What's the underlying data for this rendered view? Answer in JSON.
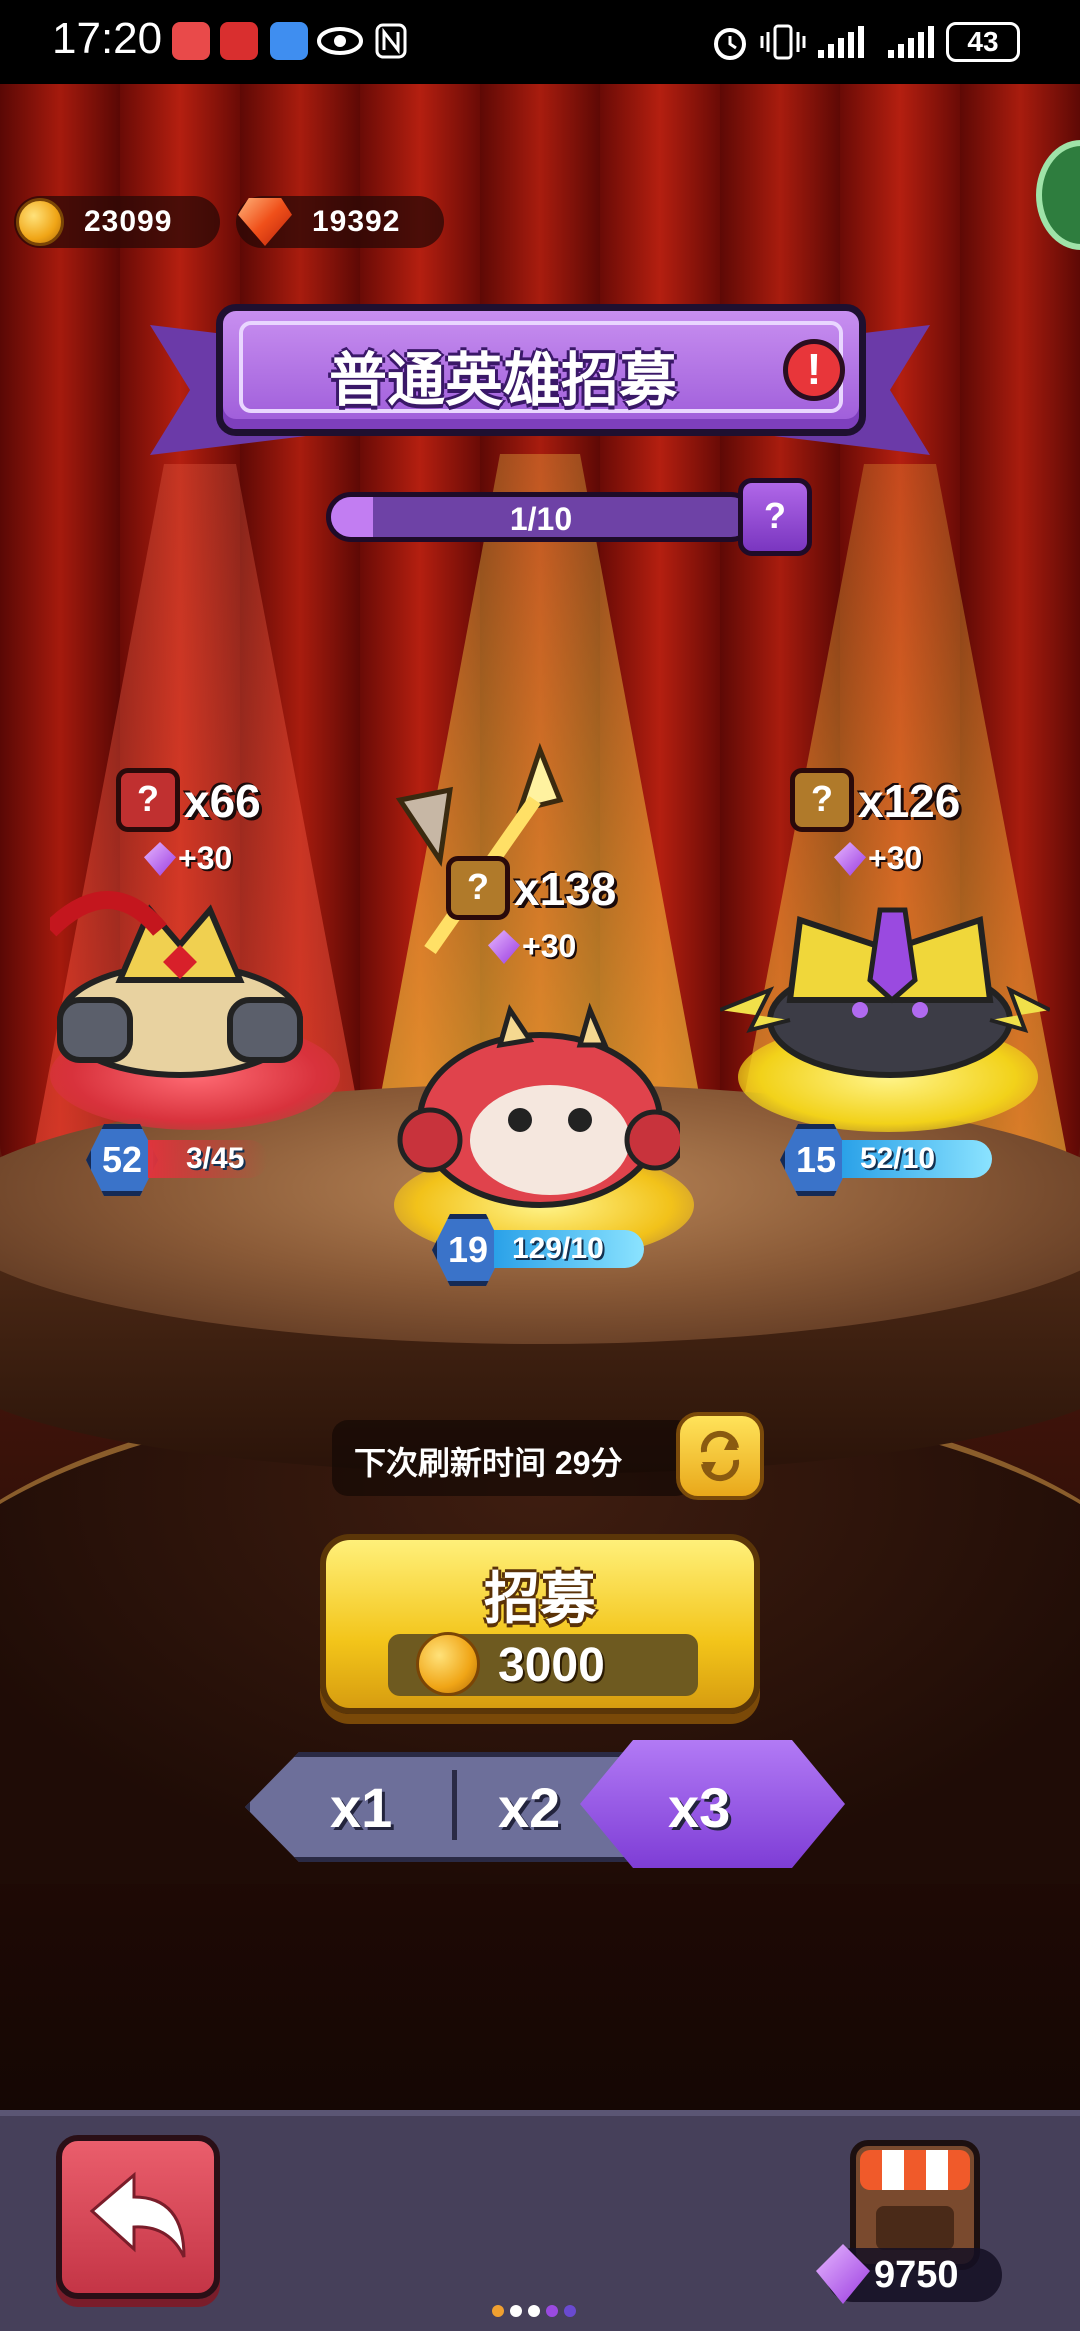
{
  "status_bar": {
    "time": "17:20",
    "battery": "43"
  },
  "currency": {
    "coins": "23099",
    "rubies": "19392"
  },
  "banner": {
    "title": "普通英雄招募",
    "alert_symbol": "!"
  },
  "progress": {
    "label": "1/10",
    "fraction": 0.1,
    "help_symbol": "?"
  },
  "heroes": [
    {
      "mystery_symbol": "?",
      "count": "x66",
      "bonus": "+30",
      "level": "52",
      "progress": "3/45",
      "accent": "#e0343c"
    },
    {
      "mystery_symbol": "?",
      "count": "x138",
      "bonus": "+30",
      "level": "19",
      "progress": "129/10",
      "accent": "#f2c21a"
    },
    {
      "mystery_symbol": "?",
      "count": "x126",
      "bonus": "+30",
      "level": "15",
      "progress": "52/10",
      "accent": "#f2d21a"
    }
  ],
  "refresh": {
    "text": "下次刷新时间 29分"
  },
  "recruit": {
    "title": "招募",
    "cost": "3000"
  },
  "multiplier": {
    "options": [
      "x1",
      "x2",
      "x3"
    ],
    "selected": "x3"
  },
  "bottom": {
    "gems": "9750"
  },
  "colors": {
    "purple_accent": "#9d5bd9",
    "gold_accent": "#f3c51a",
    "back_red": "#c43546"
  }
}
